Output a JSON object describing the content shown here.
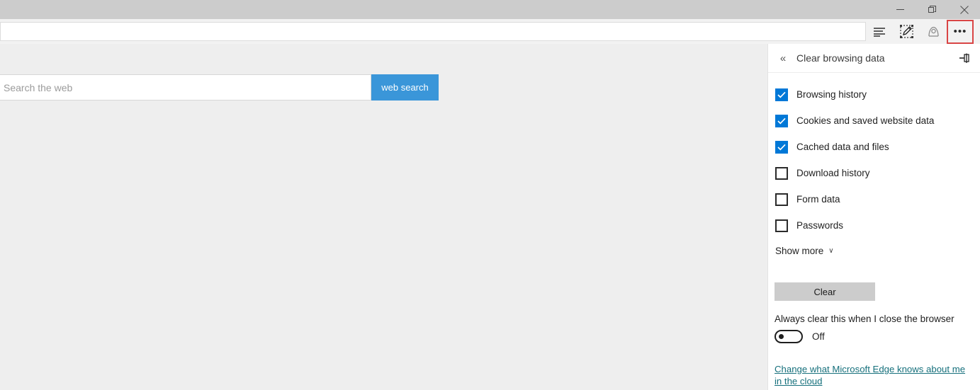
{
  "window": {
    "controls": [
      {
        "name": "minimize",
        "glyph": "─"
      },
      {
        "name": "restore",
        "glyph": "❐"
      },
      {
        "name": "close",
        "glyph": "✕"
      }
    ]
  },
  "toolbar": {
    "address_value": "",
    "address_placeholder": "",
    "icons": [
      {
        "name": "hub-icon",
        "title": "Hub (favorites, reading list, history and downloads)"
      },
      {
        "name": "web-note-icon",
        "title": "Make a Web Note"
      },
      {
        "name": "share-icon",
        "title": "Share this page"
      },
      {
        "name": "more-icon",
        "title": "Settings and more",
        "label": "•••"
      }
    ],
    "highlight_color": "#d94545"
  },
  "page": {
    "search": {
      "placeholder": "Search the web",
      "value": "",
      "button_label": "web search",
      "button_color": "#3a96d9"
    }
  },
  "panel": {
    "back_glyph": "«",
    "title": "Clear browsing data",
    "pin_title": "Pin this pane",
    "checkboxes": [
      {
        "label": "Browsing history",
        "checked": true
      },
      {
        "label": "Cookies and saved website data",
        "checked": true
      },
      {
        "label": "Cached data and files",
        "checked": true
      },
      {
        "label": "Download history",
        "checked": false
      },
      {
        "label": "Form data",
        "checked": false
      },
      {
        "label": "Passwords",
        "checked": false
      }
    ],
    "show_more_label": "Show more",
    "show_more_chevron": "∨",
    "clear_button_label": "Clear",
    "always_clear_label": "Always clear this when I close the browser",
    "toggle_state": "Off",
    "toggle_on": false,
    "cloud_link": "Change what Microsoft Edge knows about me in the cloud",
    "accent_color": "#0078d7",
    "link_color": "#16707c"
  }
}
